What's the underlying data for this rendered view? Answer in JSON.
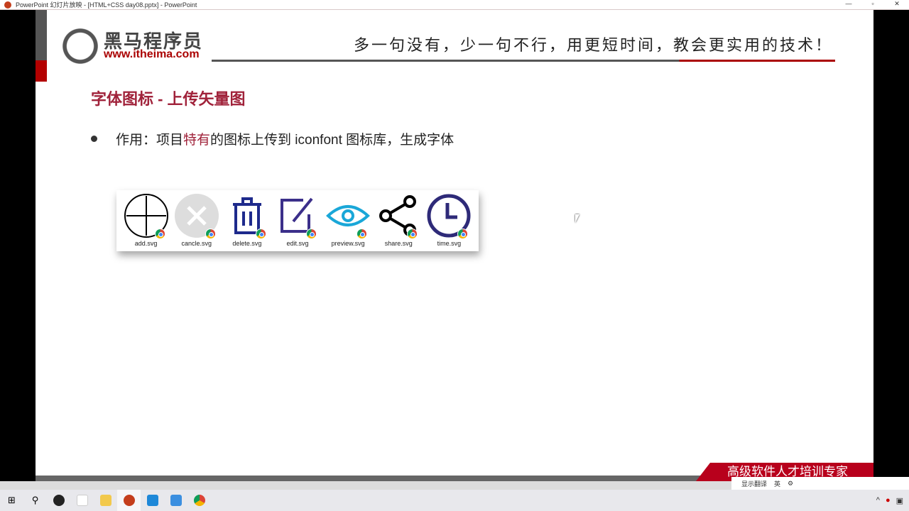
{
  "window": {
    "title": "PowerPoint 幻灯片放映 - [HTML+CSS day08.pptx] - PowerPoint",
    "min": "—",
    "max": "▫",
    "close": "✕"
  },
  "slide": {
    "brand": "黑马程序员",
    "url": "www.itheima.com",
    "slogan": "多一句没有，少一句不行，用更短时间，教会更实用的技术！",
    "heading": "字体图标 - 上传矢量图",
    "bullet": {
      "prefix": "作用：项目",
      "highlight": "特有",
      "suffix": "的图标上传到 iconfont 图标库，生成字体"
    },
    "files": [
      "add.svg",
      "cancle.svg",
      "delete.svg",
      "edit.svg",
      "preview.svg",
      "share.svg",
      "time.svg"
    ],
    "banner": "高级软件人才培训专家"
  },
  "ime": {
    "label": "显示翻译",
    "lang": "英"
  },
  "taskbar": {
    "items": [
      "start",
      "search",
      "obs",
      "typora",
      "explorer",
      "powerpoint",
      "vscode",
      "app",
      "chrome"
    ]
  }
}
